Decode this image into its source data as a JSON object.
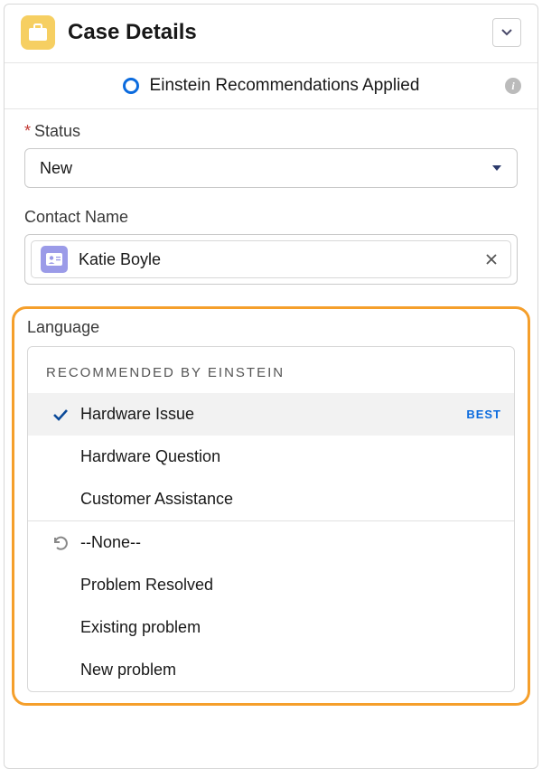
{
  "panel": {
    "title": "Case Details"
  },
  "einstein_bar": {
    "label": "Einstein Recommendations Applied"
  },
  "fields": {
    "status": {
      "label": "Status",
      "required": true,
      "value": "New"
    },
    "contact": {
      "label": "Contact Name",
      "value": "Katie Boyle"
    },
    "language": {
      "label": "Language",
      "group_header": "Recommended by Einstein",
      "recommended": [
        {
          "label": "Hardware Issue",
          "best_badge": "BEST",
          "selected": true
        },
        {
          "label": "Hardware Question",
          "selected": false
        },
        {
          "label": "Customer Assistance",
          "selected": false
        }
      ],
      "standard": [
        {
          "label": "--None--",
          "reset": true
        },
        {
          "label": "Problem Resolved"
        },
        {
          "label": "Existing problem"
        },
        {
          "label": "New problem"
        }
      ]
    }
  }
}
